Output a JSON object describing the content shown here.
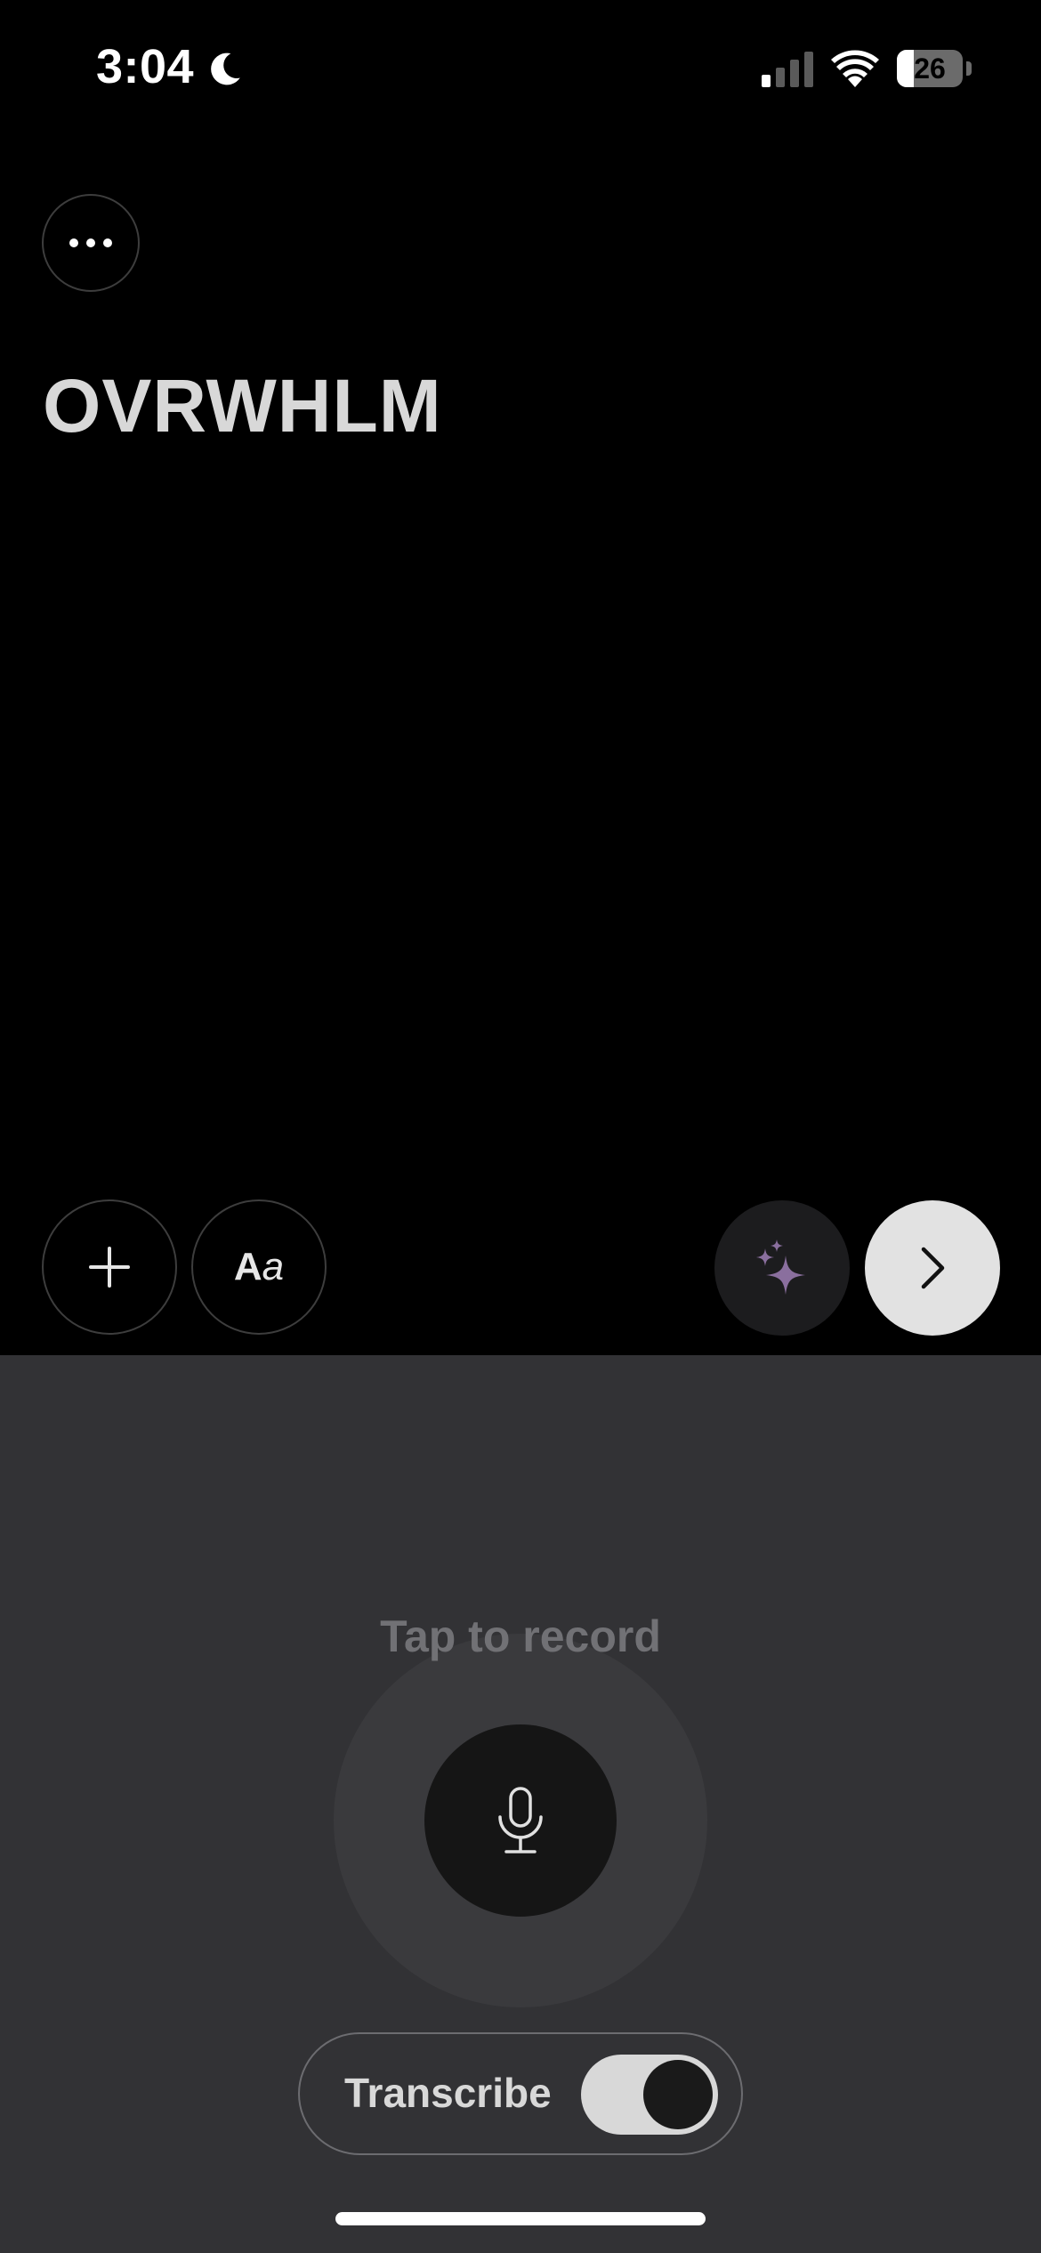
{
  "status_bar": {
    "time": "3:04",
    "battery_percent": "26",
    "battery_level": 0.26,
    "icons": [
      "moon-icon",
      "cellular-signal-icon",
      "wifi-icon",
      "battery-icon"
    ]
  },
  "header": {
    "more_button_icon": "ellipsis-icon",
    "title": "OVRWHLM"
  },
  "toolbar": {
    "add_button_icon": "plus-icon",
    "font_button_label_bold": "A",
    "font_button_label_italic": "a",
    "ai_button_icon": "sparkles-icon",
    "next_button_icon": "chevron-right-icon"
  },
  "recorder": {
    "prompt": "Tap to record",
    "mic_icon": "microphone-icon",
    "transcribe_label": "Transcribe",
    "transcribe_enabled": true
  },
  "colors": {
    "background": "#000000",
    "panel": "#323235",
    "accent_purple": "#8a6f9e",
    "title_text": "#d8d8d8"
  }
}
